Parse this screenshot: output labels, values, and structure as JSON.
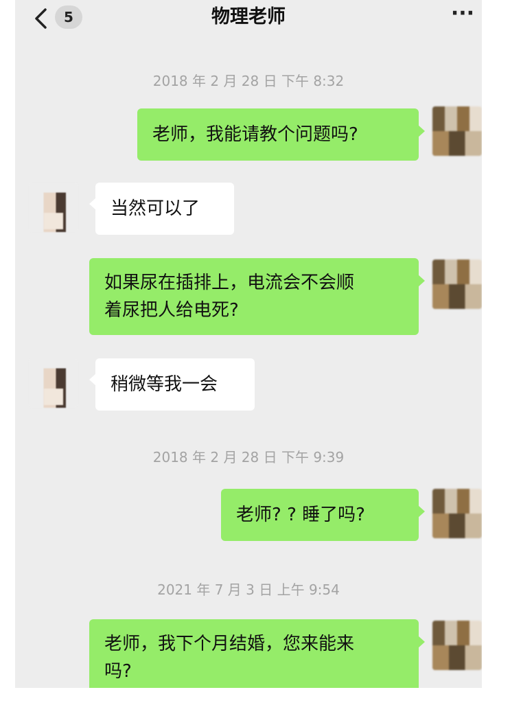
{
  "navbar": {
    "badge": "5",
    "title": "物理老师",
    "more": "···"
  },
  "messages": {
    "ts1": "2018 年 2 月 28 日 下午 8:32",
    "m1": "老师，我能请教个问题吗?",
    "m2": "当然可以了",
    "m3_line1": "如果尿在插排上，电流会不会顺",
    "m3_line2": "着尿把人给电死?",
    "m4": "稍微等我一会",
    "ts2": "2018 年 2 月 28 日 下午 9:39",
    "m5": "老师? ? 睡了吗?",
    "ts3": "2021 年 7 月 3 日 上午 9:54",
    "m6_line1": "老师，我下个月结婚，您来能来",
    "m6_line2": "吗?"
  },
  "colors": {
    "my_bubble": "#95ec69",
    "their_bubble": "#ffffff",
    "background": "#ededed",
    "timestamp": "#a3a3a3"
  },
  "icons": {
    "back": "chevron-left-icon",
    "more": "ellipsis-icon"
  }
}
